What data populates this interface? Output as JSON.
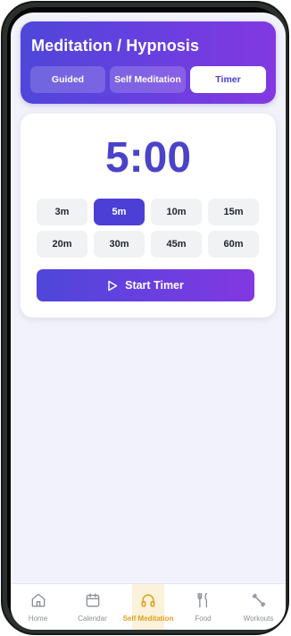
{
  "header": {
    "title": "Meditation / Hypnosis",
    "tabs": [
      {
        "label": "Guided",
        "active": false
      },
      {
        "label": "Self Meditation",
        "active": false
      },
      {
        "label": "Timer",
        "active": true
      }
    ]
  },
  "timer": {
    "display": "5:00",
    "selected_preset": "5m",
    "presets": [
      "3m",
      "5m",
      "10m",
      "15m",
      "20m",
      "30m",
      "45m",
      "60m"
    ],
    "start_label": "Start Timer"
  },
  "nav": {
    "items": [
      {
        "label": "Home",
        "icon": "home-icon",
        "active": false
      },
      {
        "label": "Calendar",
        "icon": "calendar-icon",
        "active": false
      },
      {
        "label": "Self Meditation",
        "icon": "headphones-icon",
        "active": true
      },
      {
        "label": "Food",
        "icon": "utensils-icon",
        "active": false
      },
      {
        "label": "Workouts",
        "icon": "dumbbell-icon",
        "active": false
      }
    ]
  },
  "colors": {
    "accent": "#4b3fd6",
    "accent_gradient_end": "#8238e0",
    "active_nav": "#e0a11a",
    "background": "#f2f2fb"
  }
}
